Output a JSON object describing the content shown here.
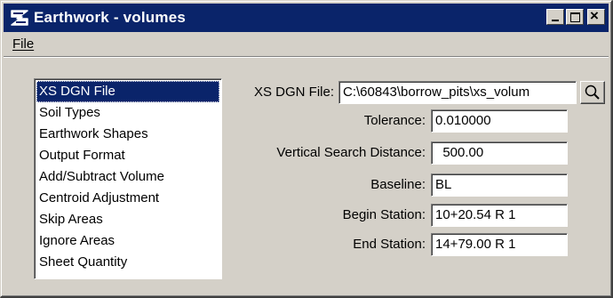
{
  "window": {
    "title": "Earthwork - volumes",
    "title_bar_color": "#0a246a"
  },
  "menu": {
    "file_label": "File"
  },
  "categories": {
    "items": [
      {
        "label": "XS DGN File",
        "selected": true
      },
      {
        "label": "Soil Types"
      },
      {
        "label": "Earthwork Shapes"
      },
      {
        "label": "Output Format"
      },
      {
        "label": "Add/Subtract Volume"
      },
      {
        "label": "Centroid Adjustment"
      },
      {
        "label": "Skip Areas"
      },
      {
        "label": "Ignore Areas"
      },
      {
        "label": "Sheet Quantity"
      }
    ]
  },
  "form": {
    "xs_dgn_file": {
      "label": "XS DGN File:",
      "value": "C:\\60843\\borrow_pits\\xs_volum"
    },
    "tolerance": {
      "label": "Tolerance:",
      "value": "0.010000"
    },
    "vertical_search_distance": {
      "label": "Vertical Search Distance:",
      "value": "  500.00"
    },
    "baseline": {
      "label": "Baseline:",
      "value": "BL"
    },
    "begin_station": {
      "label": "Begin Station:",
      "value": "10+20.54 R 1"
    },
    "end_station": {
      "label": "End Station:",
      "value": "14+79.00 R 1"
    }
  },
  "icons": {
    "app": "earthwork-logo-icon",
    "browse": "magnifier-icon"
  }
}
